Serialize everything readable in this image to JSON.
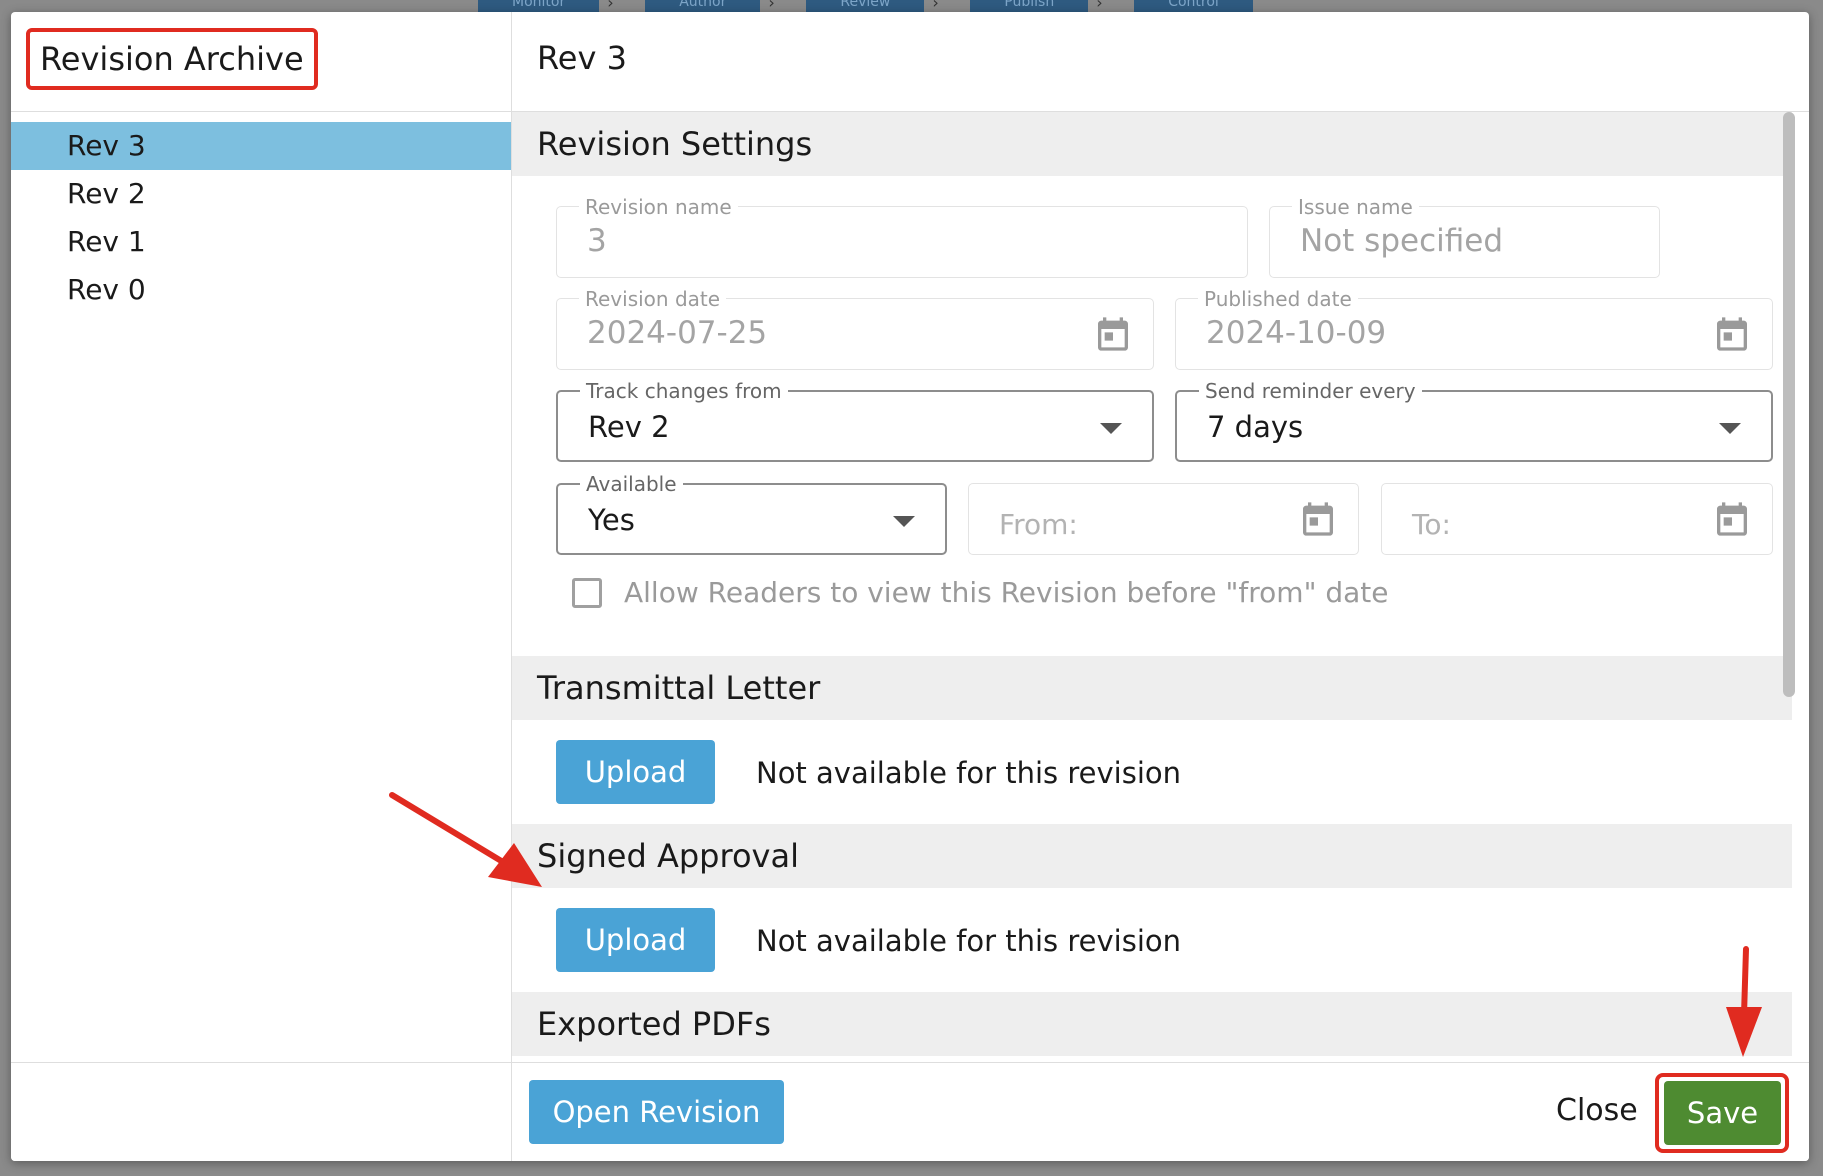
{
  "background_tabs": [
    "Monitor",
    "Author",
    "Review",
    "Publish",
    "Control"
  ],
  "archive": {
    "title": "Revision Archive",
    "revisions": [
      "Rev 3",
      "Rev 2",
      "Rev 1",
      "Rev 0"
    ],
    "selected": "Rev 3"
  },
  "detail": {
    "title": "Rev 3",
    "settings": {
      "heading": "Revision Settings",
      "revision_name": {
        "label": "Revision name",
        "value": "3"
      },
      "issue_name": {
        "label": "Issue name",
        "value": "Not specified"
      },
      "revision_date": {
        "label": "Revision date",
        "value": "2024-07-25"
      },
      "published_date": {
        "label": "Published date",
        "value": "2024-10-09"
      },
      "track_changes": {
        "label": "Track changes from",
        "value": "Rev 2"
      },
      "reminder": {
        "label": "Send reminder every",
        "value": "7 days"
      },
      "available": {
        "label": "Available",
        "value": "Yes"
      },
      "from": {
        "placeholder": "From:"
      },
      "to": {
        "placeholder": "To:"
      },
      "allow_readers": {
        "label": "Allow Readers to view this Revision before \"from\" date",
        "checked": false
      }
    },
    "transmittal": {
      "heading": "Transmittal Letter",
      "button": "Upload",
      "note": "Not available for this revision"
    },
    "signed_approval": {
      "heading": "Signed Approval",
      "button": "Upload",
      "note": "Not available for this revision"
    },
    "exported": {
      "heading": "Exported PDFs"
    }
  },
  "footer": {
    "open_revision": "Open Revision",
    "close": "Close",
    "save": "Save"
  },
  "annotation_color": "#e02b20"
}
